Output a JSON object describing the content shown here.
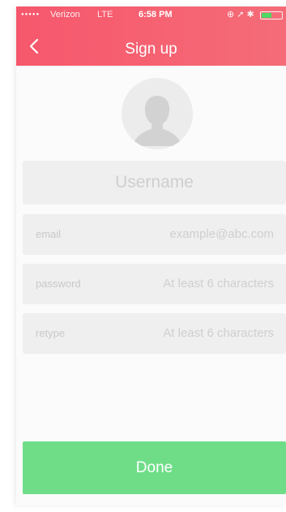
{
  "status_bar": {
    "signal": "●●●●●",
    "carrier": "Verizon",
    "network": "LTE",
    "time": "6:58 PM",
    "icons": "⊕ ➚ ✱"
  },
  "header": {
    "title": "Sign up",
    "back_icon": "chevron-left-icon",
    "background_color": "#f6576c"
  },
  "avatar": {
    "icon": "user-silhouette-icon"
  },
  "form": {
    "username": {
      "placeholder": "Username"
    },
    "email": {
      "label": "email",
      "placeholder": "example@abc.com"
    },
    "password": {
      "label": "password",
      "placeholder": "At least 6 characters"
    },
    "retype": {
      "label": "retype",
      "placeholder": "At least 6 characters"
    }
  },
  "done_button": {
    "label": "Done",
    "color": "#6fdd88"
  }
}
